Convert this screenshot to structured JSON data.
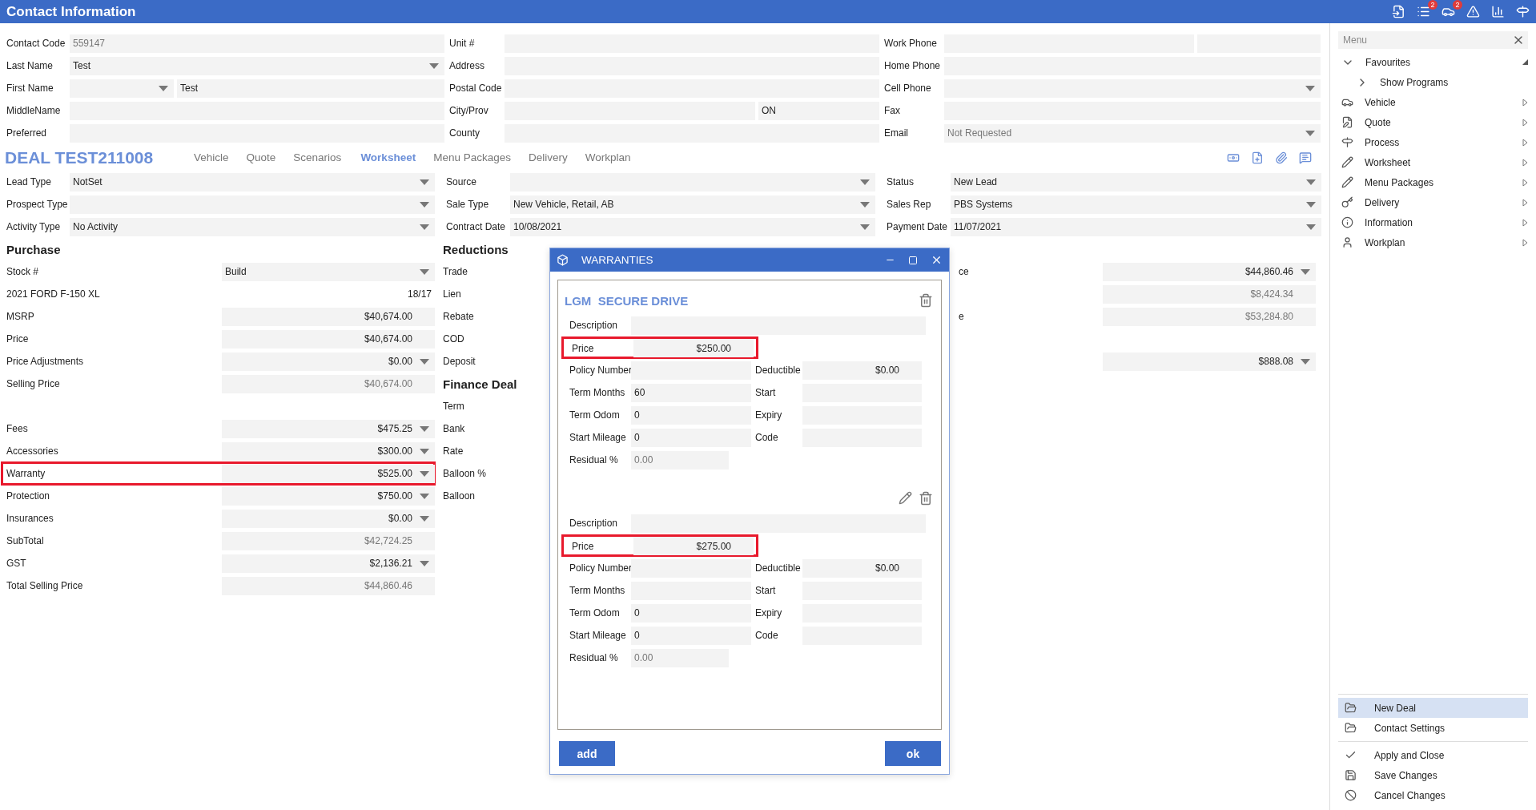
{
  "window": {
    "title": "Contact Information"
  },
  "toolbar": {
    "badges": [
      "2",
      "2"
    ]
  },
  "contact": {
    "columns": [
      [
        {
          "label": "Contact Code",
          "value": "559147",
          "kind": "readonly"
        },
        {
          "label": "Last Name",
          "value": "Test",
          "kind": "select"
        },
        {
          "label": "First Name",
          "value2": "Test",
          "kind": "select-text"
        },
        {
          "label": "MiddleName",
          "kind": "text"
        },
        {
          "label": "Preferred",
          "kind": "text"
        }
      ],
      [
        {
          "label": "Unit #",
          "kind": "text"
        },
        {
          "label": "Address",
          "kind": "text"
        },
        {
          "label": "Postal Code",
          "kind": "text"
        },
        {
          "label": "City/Prov",
          "value2": "ON",
          "kind": "text-pair"
        },
        {
          "label": "County",
          "kind": "text"
        }
      ],
      [
        {
          "label": "Work Phone",
          "kind": "text-pair"
        },
        {
          "label": "Home Phone",
          "kind": "text"
        },
        {
          "label": "Cell Phone",
          "kind": "select"
        },
        {
          "label": "Fax",
          "kind": "text"
        },
        {
          "label": "Email",
          "placeholder": "Not Requested",
          "kind": "select"
        }
      ]
    ]
  },
  "deal": {
    "title": "DEAL TEST211008",
    "tabs": [
      {
        "label": "Vehicle",
        "selected": false
      },
      {
        "label": "Quote",
        "selected": false
      },
      {
        "label": "Scenarios",
        "selected": false
      },
      {
        "label": "Worksheet",
        "selected": true
      },
      {
        "label": "Menu Packages",
        "selected": false
      },
      {
        "label": "Delivery",
        "selected": false
      },
      {
        "label": "Workplan",
        "selected": false
      }
    ],
    "columns": [
      [
        {
          "label": "Lead Type",
          "value": "NotSet",
          "kind": "select"
        },
        {
          "label": "Prospect Type",
          "kind": "select"
        },
        {
          "label": "Activity Type",
          "value": "No Activity",
          "kind": "select"
        }
      ],
      [
        {
          "label": "Source",
          "kind": "select"
        },
        {
          "label": "Sale Type",
          "value": "New Vehicle, Retail, AB",
          "kind": "select"
        },
        {
          "label": "Contract Date",
          "value": "10/08/2021",
          "kind": "select"
        }
      ],
      [
        {
          "label": "Status",
          "value": "New Lead",
          "kind": "select"
        },
        {
          "label": "Sales Rep",
          "value": "PBS Systems",
          "kind": "select"
        },
        {
          "label": "Payment Date",
          "value": "11/07/2021",
          "kind": "select"
        }
      ]
    ]
  },
  "worksheet": {
    "purchase": {
      "title": "Purchase",
      "groups": [
        [
          {
            "label": "Stock #",
            "value": "Build",
            "kind": "choice",
            "highlighted": false
          },
          {
            "label": "2021 FORD F-150 XL",
            "value": "18/17",
            "kind": "plain",
            "highlighted": false
          },
          {
            "label": "MSRP",
            "value": "$40,674.00",
            "kind": "amount",
            "highlighted": false
          },
          {
            "label": "Price",
            "value": "$40,674.00",
            "kind": "amount",
            "highlighted": false
          },
          {
            "label": "Price Adjustments",
            "value": "$0.00",
            "kind": "select",
            "highlighted": false
          },
          {
            "label": "Selling Price",
            "value": "$40,674.00",
            "kind": "readonly",
            "highlighted": false
          }
        ],
        [
          {
            "label": "Fees",
            "value": "$475.25",
            "kind": "select",
            "highlighted": false
          },
          {
            "label": "Accessories",
            "value": "$300.00",
            "kind": "select",
            "highlighted": false
          },
          {
            "label": "Warranty",
            "value": "$525.00",
            "kind": "select",
            "highlighted": true
          },
          {
            "label": "Protection",
            "value": "$750.00",
            "kind": "select",
            "highlighted": false
          },
          {
            "label": "Insurances",
            "value": "$0.00",
            "kind": "select",
            "highlighted": false
          },
          {
            "label": "SubTotal",
            "value": "$42,724.25",
            "kind": "readonly",
            "highlighted": false
          },
          {
            "label": "GST",
            "value": "$2,136.21",
            "kind": "select",
            "highlighted": false
          },
          {
            "label": "Total Selling Price",
            "value": "$44,860.46",
            "kind": "readonly",
            "highlighted": false
          }
        ]
      ]
    },
    "sections": [
      {
        "title": "Reductions",
        "labels": [
          "Trade",
          "Lien",
          "Rebate",
          "COD",
          "Deposit"
        ]
      },
      {
        "title": "Finance Deal",
        "labels": [
          "Term",
          "Bank",
          "Rate",
          "Balloon %",
          "Balloon"
        ]
      }
    ],
    "payable": {
      "groups": [
        [
          {
            "label": "ce",
            "value": "$44,860.46",
            "kind": "select"
          },
          {
            "value": "$8,424.34",
            "kind": "readonly"
          },
          {
            "label": "e",
            "value": "$53,284.80",
            "kind": "readonly"
          }
        ],
        [
          {
            "value": "$888.08",
            "kind": "select"
          }
        ]
      ]
    }
  },
  "modal": {
    "title": "WARRANTIES",
    "cards": [
      {
        "title": "LGM  SECURE DRIVE",
        "editable": false,
        "rows": [
          {
            "kind": "wide",
            "label": "Description"
          },
          {
            "kind": "price",
            "label": "Price",
            "value": "$250.00",
            "highlighted": true
          },
          {
            "kind": "pair",
            "label": "Policy Number",
            "label2": "Deductible",
            "value2": "$0.00"
          },
          {
            "kind": "pair",
            "label": "Term Months",
            "value": "60",
            "label2": "Start"
          },
          {
            "kind": "pair",
            "label": "Term Odom",
            "value": "0",
            "label2": "Expiry"
          },
          {
            "kind": "pair",
            "label": "Start Mileage",
            "value": "0",
            "label2": "Code"
          },
          {
            "kind": "readonly",
            "label": "Residual %",
            "value": "0.00"
          }
        ]
      },
      {
        "editable": true,
        "rows": [
          {
            "kind": "wide",
            "label": "Description"
          },
          {
            "kind": "price",
            "label": "Price",
            "value": "$275.00",
            "highlighted": true
          },
          {
            "kind": "pair",
            "label": "Policy Number",
            "label2": "Deductible",
            "value2": "$0.00"
          },
          {
            "kind": "pair",
            "label": "Term Months",
            "label2": "Start"
          },
          {
            "kind": "pair",
            "label": "Term Odom",
            "value": "0",
            "label2": "Expiry"
          },
          {
            "kind": "pair",
            "label": "Start Mileage",
            "value": "0",
            "label2": "Code"
          },
          {
            "kind": "readonly",
            "label": "Residual %",
            "value": "0.00"
          }
        ]
      }
    ],
    "buttons": [
      "add",
      "ok"
    ]
  },
  "menu": {
    "search": {
      "placeholder": "Menu"
    },
    "items": [
      {
        "label": "Favourites",
        "kind": "group",
        "expanded": true,
        "children": [
          {
            "label": "Show Programs",
            "kind": "group",
            "expanded": false
          }
        ]
      },
      {
        "label": "Vehicle",
        "kind": "submenu"
      },
      {
        "label": "Quote",
        "kind": "submenu"
      },
      {
        "label": "Process",
        "kind": "submenu"
      },
      {
        "label": "Worksheet",
        "kind": "submenu"
      },
      {
        "label": "Menu Packages",
        "kind": "submenu"
      },
      {
        "label": "Delivery",
        "kind": "submenu"
      },
      {
        "label": "Information",
        "kind": "submenu"
      },
      {
        "label": "Workplan",
        "kind": "submenu"
      }
    ],
    "deal_actions": [
      {
        "label": "New Deal",
        "selected": true
      },
      {
        "label": "Contact Settings",
        "selected": false
      }
    ],
    "actions": [
      {
        "label": "Apply and Close"
      },
      {
        "label": "Save Changes"
      },
      {
        "label": "Cancel Changes"
      }
    ]
  }
}
